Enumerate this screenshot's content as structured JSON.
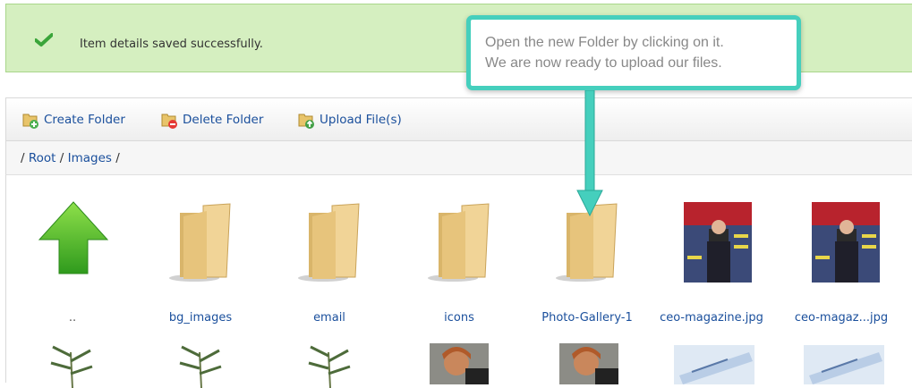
{
  "notification": {
    "message": "Item details saved successfully.",
    "icon": "checkmark-icon"
  },
  "toolbar": {
    "create_folder": "Create Folder",
    "delete_folder": "Delete Folder",
    "upload_files": "Upload File(s)"
  },
  "breadcrumb": {
    "sep1": "/",
    "root": "Root",
    "sep2": "/",
    "images": "Images",
    "sep3": "/"
  },
  "callout": {
    "line1": "Open the new Folder by clicking on it.",
    "line2": "We are now ready to upload our files."
  },
  "items": [
    {
      "label": "..",
      "type": "up-arrow"
    },
    {
      "label": "bg_images",
      "type": "folder"
    },
    {
      "label": "email",
      "type": "folder"
    },
    {
      "label": "icons",
      "type": "folder"
    },
    {
      "label": "Photo-Gallery-1",
      "type": "folder"
    },
    {
      "label": "ceo-magazine.jpg",
      "type": "image"
    },
    {
      "label": "ceo-magaz...jpg",
      "type": "image"
    }
  ],
  "colors": {
    "accent": "#45cfbd",
    "link": "#1a4f9c",
    "success_bg": "#d5efc0"
  }
}
